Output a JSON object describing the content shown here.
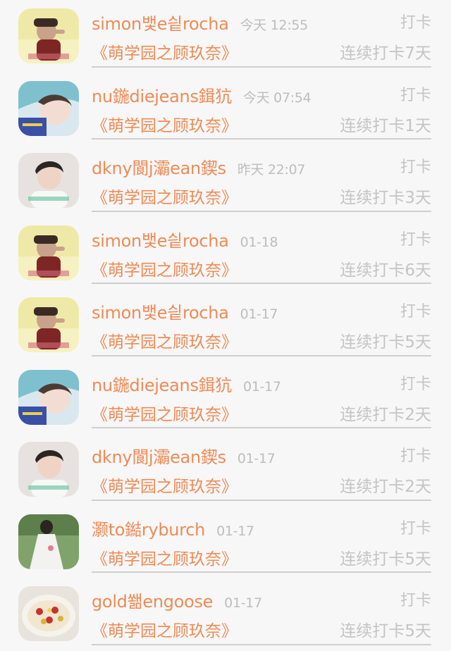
{
  "entries": [
    {
      "name": "simon뱇e싙rocha",
      "time": "今天 12:55",
      "action": "打卡",
      "book": "《萌学园之顾玖奈》",
      "streak": "连续打卡7天",
      "avatar": "boy-red-hat"
    },
    {
      "name": "nu鍦diejeans鍓犺",
      "time": "今天 07:54",
      "action": "打卡",
      "book": "《萌学园之顾玖奈》",
      "streak": "连续打卡1天",
      "avatar": "girl-blue-scarf"
    },
    {
      "name": "dkny閬j灞ean鍥s",
      "time": "昨天 22:07",
      "action": "打卡",
      "book": "《萌学园之顾玖奈》",
      "streak": "连续打卡3天",
      "avatar": "boy-white-shirt"
    },
    {
      "name": "simon뱇e싙rocha",
      "time": "01-18",
      "action": "打卡",
      "book": "《萌学园之顾玖奈》",
      "streak": "连续打卡6天",
      "avatar": "boy-red-hat"
    },
    {
      "name": "simon뱇e싙rocha",
      "time": "01-17",
      "action": "打卡",
      "book": "《萌学园之顾玖奈》",
      "streak": "连续打卡5天",
      "avatar": "boy-red-hat"
    },
    {
      "name": "nu鍦diejeans鍓犺",
      "time": "01-17",
      "action": "打卡",
      "book": "《萌学园之顾玖奈》",
      "streak": "连续打卡2天",
      "avatar": "girl-blue-scarf"
    },
    {
      "name": "dkny閬j灞ean鍥s",
      "time": "01-17",
      "action": "打卡",
      "book": "《萌学园之顾玖奈》",
      "streak": "连续打卡2天",
      "avatar": "boy-white-shirt"
    },
    {
      "name": "灏to鐑ryburch",
      "time": "01-17",
      "action": "打卡",
      "book": "《萌学园之顾玖奈》",
      "streak": "连续打卡5天",
      "avatar": "girl-white-dress"
    },
    {
      "name": "gold쐚engoose",
      "time": "01-17",
      "action": "打卡",
      "book": "《萌学园之顾玖奈》",
      "streak": "连续打卡5天",
      "avatar": "dessert-bowl"
    }
  ],
  "colors": {
    "name_accent": "#ee8b55",
    "muted_text": "#bdbdbd",
    "background": "#f8f7f8",
    "divider": "#cfcfcf"
  }
}
